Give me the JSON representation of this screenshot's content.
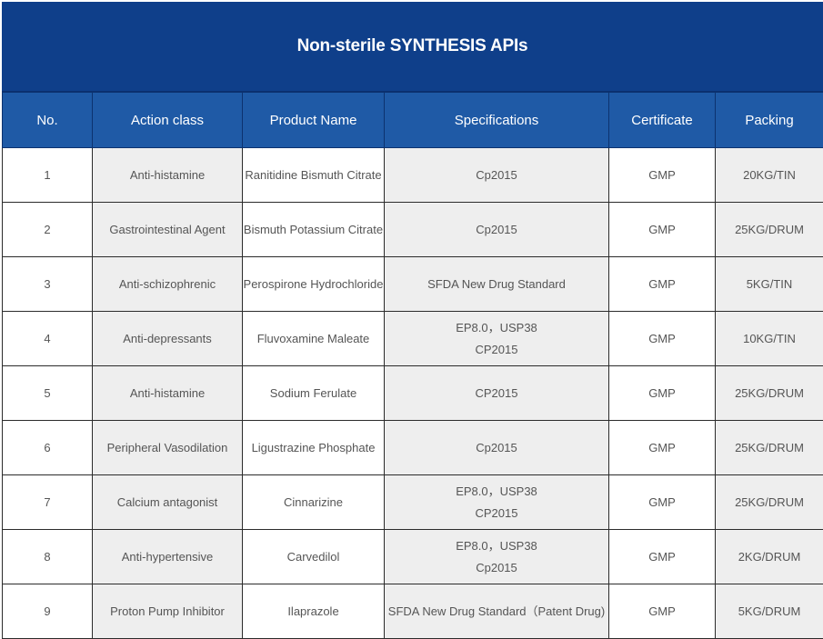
{
  "title": "Non-sterile SYNTHESIS APIs",
  "columns": [
    "No.",
    "Action class",
    "Product Name",
    "Specifications",
    "Certificate",
    "Packing"
  ],
  "rows": [
    {
      "no": "1",
      "action_class": "Anti-histamine",
      "product_name": "Ranitidine Bismuth Citrate",
      "spec_lines": [
        "Cp2015"
      ],
      "certificate": "GMP",
      "packing": "20KG/TIN"
    },
    {
      "no": "2",
      "action_class": "Gastrointestinal Agent",
      "product_name": "Bismuth Potassium Citrate",
      "spec_lines": [
        "Cp2015"
      ],
      "certificate": "GMP",
      "packing": "25KG/DRUM"
    },
    {
      "no": "3",
      "action_class": "Anti-schizophrenic",
      "product_name": "Perospirone Hydrochloride",
      "spec_lines": [
        "SFDA New Drug Standard"
      ],
      "certificate": "GMP",
      "packing": "5KG/TIN"
    },
    {
      "no": "4",
      "action_class": "Anti-depressants",
      "product_name": "Fluvoxamine Maleate",
      "spec_lines": [
        "EP8.0，USP38",
        "CP2015"
      ],
      "certificate": "GMP",
      "packing": "10KG/TIN"
    },
    {
      "no": "5",
      "action_class": "Anti-histamine",
      "product_name": "Sodium Ferulate",
      "spec_lines": [
        "CP2015"
      ],
      "certificate": "GMP",
      "packing": "25KG/DRUM"
    },
    {
      "no": "6",
      "action_class": "Peripheral Vasodilation",
      "product_name": "Ligustrazine Phosphate",
      "spec_lines": [
        "Cp2015"
      ],
      "certificate": "GMP",
      "packing": "25KG/DRUM"
    },
    {
      "no": "7",
      "action_class": "Calcium antagonist",
      "product_name": "Cinnarizine",
      "spec_lines": [
        "EP8.0，USP38",
        "CP2015"
      ],
      "certificate": "GMP",
      "packing": "25KG/DRUM"
    },
    {
      "no": "8",
      "action_class": "Anti-hypertensive",
      "product_name": "Carvedilol",
      "spec_lines": [
        "EP8.0，USP38",
        "Cp2015"
      ],
      "certificate": "GMP",
      "packing": "2KG/DRUM"
    },
    {
      "no": "9",
      "action_class": "Proton Pump Inhibitor",
      "product_name": "Ilaprazole",
      "spec_lines": [
        "SFDA New Drug Standard（Patent Drug)"
      ],
      "certificate": "GMP",
      "packing": "5KG/DRUM"
    }
  ],
  "colors": {
    "title_bg": "#0f3f8a",
    "header_bg": "#1f5aa6",
    "shaded_cell": "#eeeeee",
    "text": "#555555"
  }
}
